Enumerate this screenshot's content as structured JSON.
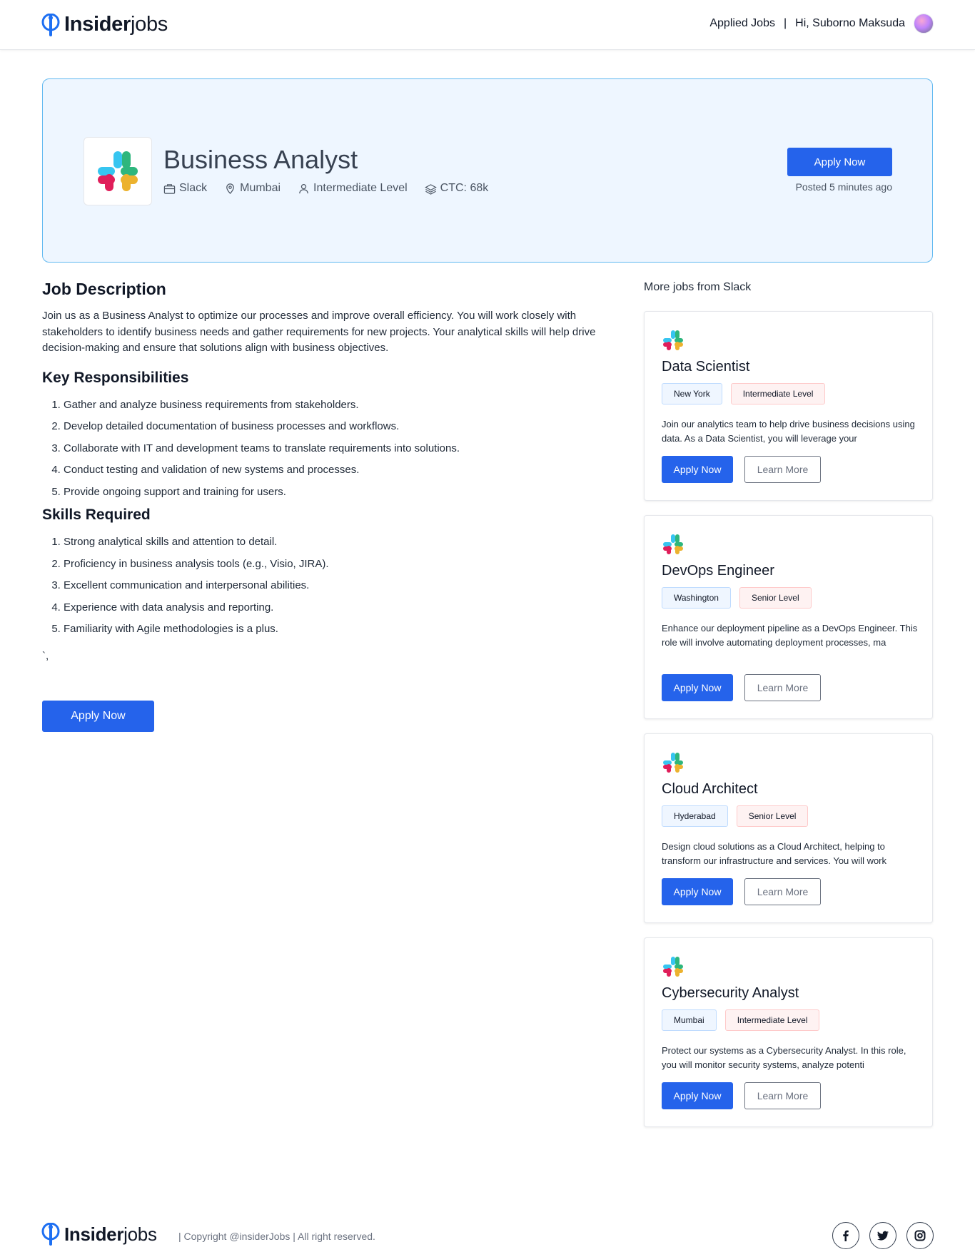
{
  "header": {
    "brand_bold": "Insider",
    "brand_light": "jobs",
    "applied_jobs": "Applied Jobs",
    "separator": "|",
    "greeting": "Hi, Suborno Maksuda"
  },
  "hero": {
    "title": "Business Analyst",
    "company": "Slack",
    "location": "Mumbai",
    "level": "Intermediate Level",
    "ctc": "CTC: 68k",
    "apply_label": "Apply Now",
    "posted": "Posted 5 minutes ago"
  },
  "job": {
    "description_heading": "Job Description",
    "description": "Join us as a Business Analyst to optimize our processes and improve overall efficiency. You will work closely with stakeholders to identify business needs and gather requirements for new projects. Your analytical skills will help drive decision-making and ensure that solutions align with business objectives.",
    "responsibilities_heading": "Key Responsibilities",
    "responsibilities": [
      "Gather and analyze business requirements from stakeholders.",
      "Develop detailed documentation of business processes and workflows.",
      "Collaborate with IT and development teams to translate requirements into solutions.",
      "Conduct testing and validation of new systems and processes.",
      "Provide ongoing support and training for users."
    ],
    "skills_heading": "Skills Required",
    "skills": [
      "Strong analytical skills and attention to detail.",
      "Proficiency in business analysis tools (e.g., Visio, JIRA).",
      "Excellent communication and interpersonal abilities.",
      "Experience with data analysis and reporting.",
      "Familiarity with Agile methodologies is a plus."
    ],
    "trailing_text": "`,",
    "apply_label": "Apply Now"
  },
  "sidebar": {
    "title": "More jobs from Slack",
    "cards": [
      {
        "title": "Data Scientist",
        "location": "New York",
        "level": "Intermediate Level",
        "description": "Join our analytics team to help drive business decisions using data. As a Data Scientist, you will leverage your",
        "apply_label": "Apply Now",
        "learn_label": "Learn More"
      },
      {
        "title": "DevOps Engineer",
        "location": "Washington",
        "level": "Senior Level",
        "description": "Enhance our deployment pipeline as a DevOps Engineer. This role will involve automating deployment processes, ma",
        "apply_label": "Apply Now",
        "learn_label": "Learn More"
      },
      {
        "title": "Cloud Architect",
        "location": "Hyderabad",
        "level": "Senior Level",
        "description": "Design cloud solutions as a Cloud Architect, helping to transform our infrastructure and services. You will work",
        "apply_label": "Apply Now",
        "learn_label": "Learn More"
      },
      {
        "title": "Cybersecurity Analyst",
        "location": "Mumbai",
        "level": "Intermediate Level",
        "description": "Protect our systems as a Cybersecurity Analyst. In this role, you will monitor security systems, analyze potenti",
        "apply_label": "Apply Now",
        "learn_label": "Learn More"
      }
    ]
  },
  "footer": {
    "brand_bold": "Insider",
    "brand_light": "jobs",
    "copyright": "| Copyright @insiderJobs | All right reserved.",
    "socials": [
      "facebook-icon",
      "twitter-icon",
      "instagram-icon"
    ]
  },
  "colors": {
    "primary": "#2563eb",
    "hero_bg": "#eef6ff",
    "hero_border": "#60b8f0",
    "slack_blue": "#36c5f0",
    "slack_green": "#2eb67d",
    "slack_red": "#e01e5a",
    "slack_yellow": "#ecb22e"
  }
}
